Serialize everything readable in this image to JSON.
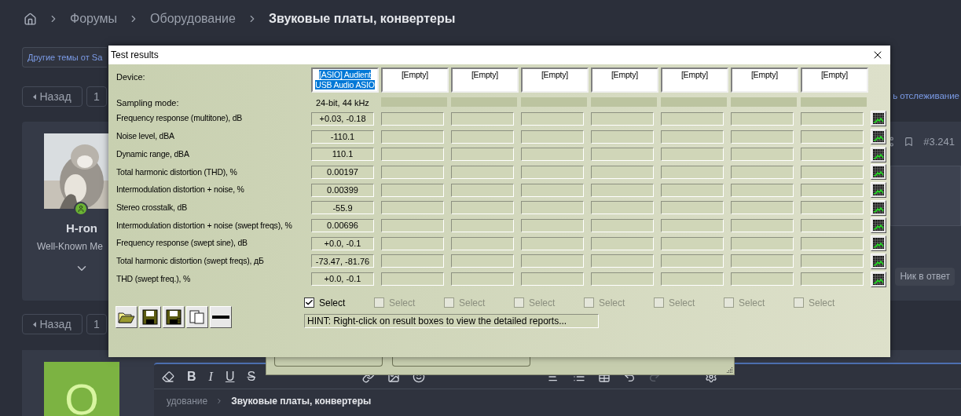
{
  "breadcrumb": [
    {
      "label": "Форумы",
      "current": false
    },
    {
      "label": "Оборудование",
      "current": false
    },
    {
      "label": "Звуковые платы, конвертеры",
      "current": true
    }
  ],
  "other_topics_button": "Другие темы от Sa",
  "pagination_top": {
    "back": "Назад",
    "page": "1"
  },
  "watch_link": "ь отслеживание",
  "post": {
    "author": "H-ron",
    "role": "Well-Known Me",
    "number": "#3.241",
    "online": true,
    "quote_button": "Ник в ответ"
  },
  "pagination_bottom": {
    "back": "Назад",
    "page": "1"
  },
  "reply": {
    "avatar_letter": "O",
    "toolbar": [
      "B",
      "I",
      "U",
      "S"
    ],
    "quote_breadcrumb": [
      "удование",
      "Звуковые платы, конвертеры"
    ]
  },
  "dialog": {
    "title": "Test results",
    "device_label": "Device:",
    "sampling_label": "Sampling mode:",
    "devices": [
      {
        "name": "[ASIO] Audient USB Audio ASIO",
        "selected": true,
        "sampling": "24-bit, 44 kHz",
        "select": {
          "label": "Select",
          "checked": true,
          "disabled": false
        }
      },
      {
        "name": "[Empty]",
        "selected": false,
        "select": {
          "label": "Select",
          "checked": false,
          "disabled": true
        }
      },
      {
        "name": "[Empty]",
        "selected": false,
        "select": {
          "label": "Select",
          "checked": false,
          "disabled": true
        }
      },
      {
        "name": "[Empty]",
        "selected": false,
        "select": {
          "label": "Select",
          "checked": false,
          "disabled": true
        }
      },
      {
        "name": "[Empty]",
        "selected": false,
        "select": {
          "label": "Select",
          "checked": false,
          "disabled": true
        }
      },
      {
        "name": "[Empty]",
        "selected": false,
        "select": {
          "label": "Select",
          "checked": false,
          "disabled": true
        }
      },
      {
        "name": "[Empty]",
        "selected": false,
        "select": {
          "label": "Select",
          "checked": false,
          "disabled": true
        }
      },
      {
        "name": "[Empty]",
        "selected": false,
        "select": {
          "label": "Select",
          "checked": false,
          "disabled": true
        }
      }
    ],
    "results": [
      {
        "label": "Frequency response (multitone), dB",
        "values": [
          "+0.03, -0.18"
        ]
      },
      {
        "label": "Noise level, dBA",
        "values": [
          "-110.1"
        ]
      },
      {
        "label": "Dynamic range, dBA",
        "values": [
          "110.1"
        ]
      },
      {
        "label": "Total harmonic distortion (THD), %",
        "values": [
          "0.00197"
        ]
      },
      {
        "label": "Intermodulation distortion + noise, %",
        "values": [
          "0.00399"
        ]
      },
      {
        "label": "Stereo crosstalk, dB",
        "values": [
          "-55.9"
        ]
      },
      {
        "label": "Intermodulation distortion + noise (swept freqs), %",
        "values": [
          "0.00696"
        ]
      },
      {
        "label": "Frequency response (swept sine), dB",
        "values": [
          "+0.0, -0.1"
        ]
      },
      {
        "label": "Total harmonic distortion (swept freqs), дБ",
        "values": [
          "-73.47, -81.76"
        ]
      },
      {
        "label": "THD (swept freq.), %",
        "values": [
          "+0.0, -0.1"
        ]
      }
    ],
    "hint": "HINT: Right-click on result boxes to view the detailed reports..."
  }
}
